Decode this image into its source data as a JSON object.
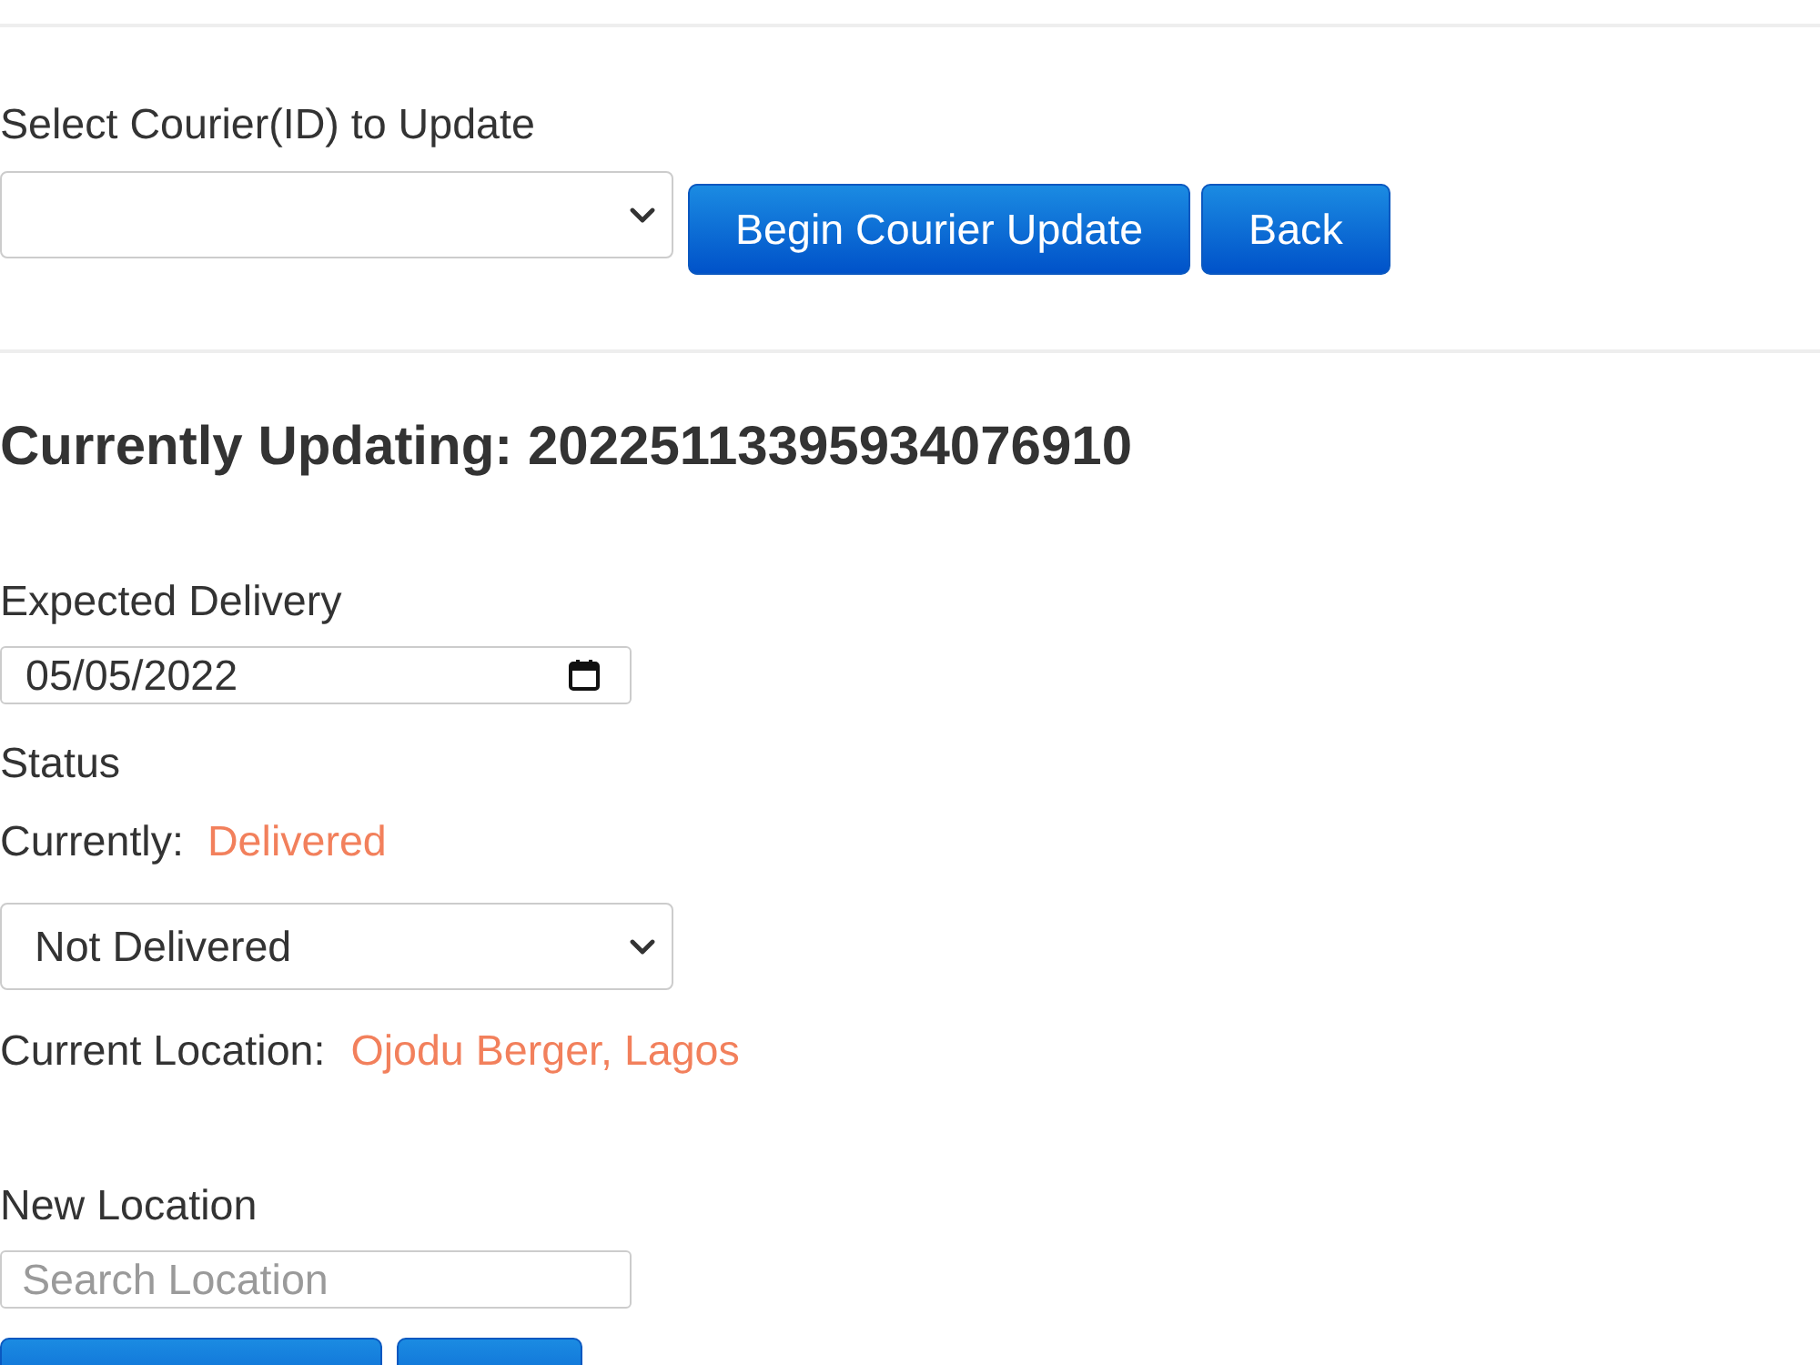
{
  "courier_select": {
    "label": "Select Courier(ID) to Update"
  },
  "buttons": [
    {
      "label": "Begin Courier Update",
      "kind": "primary"
    },
    {
      "label": "Back",
      "kind": "primary"
    }
  ],
  "heading": "Currently Updating: 20225113395934076910",
  "expected_delivery": {
    "label": "Expected Delivery",
    "value": "05/05/2022"
  },
  "status": {
    "label": "Status",
    "current_label": "Currently:",
    "current_value": "Delivered",
    "select_value": "Not Delivered"
  },
  "current_location": {
    "label": "Current Location:",
    "value": "Ojodu Berger, Lagos"
  },
  "new_location": {
    "label": "New Location",
    "placeholder": "Search Location"
  },
  "cut_off_buttons": [
    {
      "kind": "primary"
    },
    {
      "kind": "primary"
    }
  ]
}
